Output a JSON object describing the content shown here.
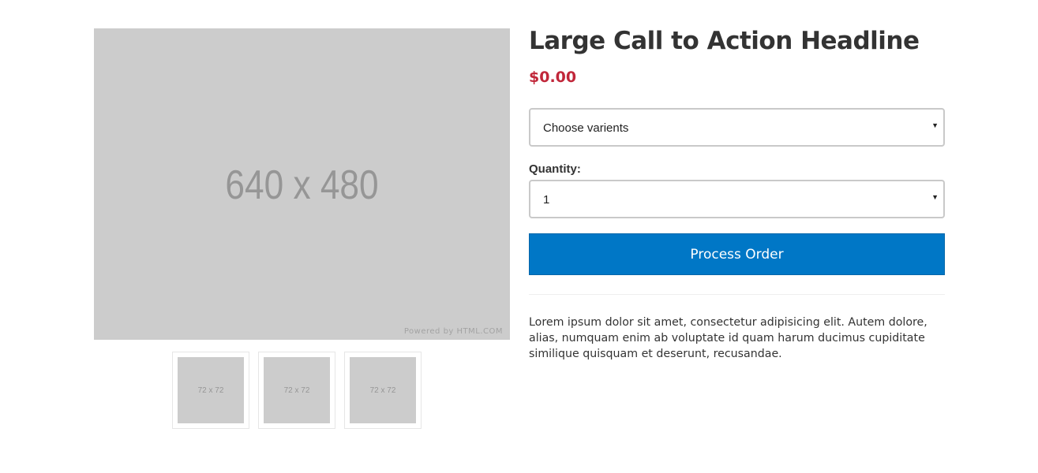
{
  "gallery": {
    "main_image_text": "640 x 480",
    "watermark": "Powered by HTML.COM",
    "thumbnails": [
      {
        "text": "72 x 72"
      },
      {
        "text": "72 x 72"
      },
      {
        "text": "72 x 72"
      }
    ]
  },
  "product": {
    "title": "Large Call to Action Headline",
    "price": "$0.00",
    "variant_select": {
      "value": "Choose varients"
    },
    "quantity_label": "Quantity:",
    "quantity_select": {
      "value": "1"
    },
    "order_button_label": "Process Order",
    "description": "Lorem ipsum dolor sit amet, consectetur adipisicing elit. Autem dolore, alias, numquam enim ab voluptate id quam harum ducimus cupiditate similique quisquam et deserunt, recusandae."
  },
  "colors": {
    "price": "#c1273a",
    "button": "#0077c6",
    "placeholder": "#cccccc"
  }
}
